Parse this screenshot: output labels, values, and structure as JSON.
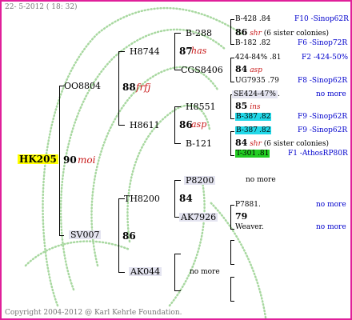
{
  "header": {
    "date_label": "22-  5-2012 ( 18: 32)"
  },
  "footer": {
    "copyright": "Copyright 2004-2012 @ Karl Kehrle Foundation."
  },
  "colors": {
    "border": "#e0209a",
    "yellow": "#ffff00",
    "cyan": "#22d8e8",
    "green": "#22cc22",
    "watermark": "#a8d8a0"
  },
  "root": {
    "id": "HK205",
    "number": "90",
    "tag": "moi"
  },
  "gen1": {
    "sire": {
      "id": "OO8804",
      "number": "88",
      "tag": "frfj"
    },
    "dam": {
      "id": "SV007",
      "number": "86"
    }
  },
  "gen2": {
    "a": {
      "id": "H8744",
      "number": "87",
      "tag": "has"
    },
    "b": {
      "id": "H8611",
      "number": "86",
      "tag": "asp"
    },
    "c": {
      "id": "TH8200",
      "number": "84"
    },
    "d": {
      "id": "AK044",
      "no_more": "no more"
    }
  },
  "gen3": {
    "a1": "B-288",
    "a2": "CGS8406",
    "b1": "H8551",
    "b1_number": "85",
    "b1_tag": "ins",
    "b2": "B-121",
    "c1": "P8200",
    "c1_no_more": "no more",
    "c2": "AK7926",
    "c2_number": "79"
  },
  "gen4": {
    "r1": {
      "name": "B-428",
      "num": ".84",
      "src": "F10 -Sinop62R"
    },
    "r2": {
      "num": "86",
      "tag": "shr",
      "note": "(6 sister colonies)"
    },
    "r3": {
      "name": "B-182",
      "num": ".82",
      "src": "F6 -Sinop72R"
    },
    "r4": {
      "name": "424-84%",
      "num": ".81",
      "src": "F2 -424-50%"
    },
    "r5": {
      "num": "84",
      "tag": "asp"
    },
    "r6": {
      "name": "UG7935",
      "num": ".79",
      "src": "F8 -Sinop62R"
    },
    "r7": {
      "name": "SE424-47%",
      "num": ".",
      "src": "no more"
    },
    "r8": {
      "num": "85",
      "tag": "ins"
    },
    "r9": {
      "name": "B-387",
      "num": ".82",
      "src": "F9 -Sinop62R"
    },
    "r10": {
      "name": "B-387",
      "num": ".82",
      "src": "F9 -Sinop62R"
    },
    "r11": {
      "num": "84",
      "tag": "shr",
      "note": "(6 sister colonies)"
    },
    "r12": {
      "name": "T-301",
      "num": ".81",
      "src": "F1 -AthosRP80R"
    },
    "r13": {
      "name": "P7881",
      "num": ".",
      "src": "no more"
    },
    "r14": {
      "num": "79"
    },
    "r15": {
      "name": "Weaver",
      "num": ".",
      "src": "no more"
    }
  }
}
